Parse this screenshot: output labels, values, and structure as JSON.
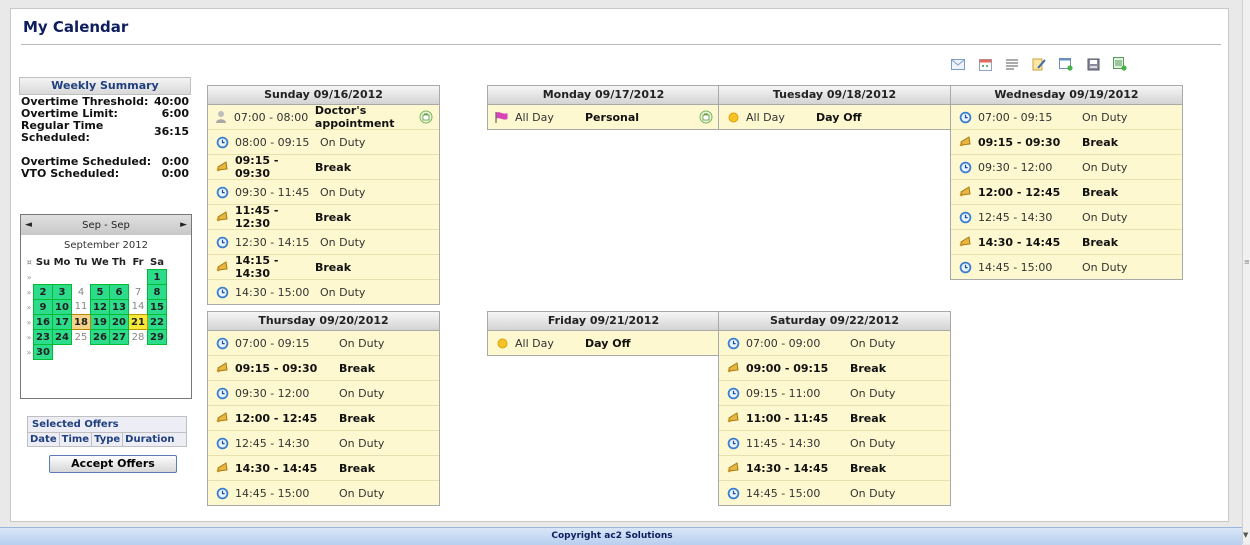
{
  "page": {
    "title": "My Calendar"
  },
  "toolbar": {
    "icons": [
      "email-icon",
      "calendar-icon",
      "list-icon",
      "edit-note-icon",
      "new-window-icon",
      "print-icon",
      "export-icon"
    ]
  },
  "summary": {
    "title": "Weekly Summary",
    "rows": [
      {
        "label": "Overtime Threshold:",
        "value": "40:00"
      },
      {
        "label": "Overtime Limit:",
        "value": "6:00"
      },
      {
        "label": "Regular Time Scheduled:",
        "value": "36:15"
      },
      {
        "label": "Overtime Scheduled:",
        "value": "0:00"
      },
      {
        "label": "VTO Scheduled:",
        "value": "0:00"
      }
    ]
  },
  "mini_calendar": {
    "range": "Sep - Sep",
    "month": "September 2012",
    "prev": "◄",
    "next": "►",
    "weekdays": [
      "Su",
      "Mo",
      "Tu",
      "We",
      "Th",
      "Fr",
      "Sa"
    ],
    "weeks": [
      [
        null,
        null,
        null,
        null,
        null,
        null,
        {
          "d": "1",
          "s": "avail"
        }
      ],
      [
        {
          "d": "2",
          "s": "avail"
        },
        {
          "d": "3",
          "s": "avail"
        },
        {
          "d": "4",
          "s": "off"
        },
        {
          "d": "5",
          "s": "avail"
        },
        {
          "d": "6",
          "s": "avail"
        },
        {
          "d": "7",
          "s": "off"
        },
        {
          "d": "8",
          "s": "avail"
        }
      ],
      [
        {
          "d": "9",
          "s": "avail"
        },
        {
          "d": "10",
          "s": "avail"
        },
        {
          "d": "11",
          "s": "off"
        },
        {
          "d": "12",
          "s": "avail"
        },
        {
          "d": "13",
          "s": "avail"
        },
        {
          "d": "14",
          "s": "off"
        },
        {
          "d": "15",
          "s": "avail"
        }
      ],
      [
        {
          "d": "16",
          "s": "avail"
        },
        {
          "d": "17",
          "s": "avail"
        },
        {
          "d": "18",
          "s": "today"
        },
        {
          "d": "19",
          "s": "avail"
        },
        {
          "d": "20",
          "s": "avail"
        },
        {
          "d": "21",
          "s": "sel"
        },
        {
          "d": "22",
          "s": "avail"
        }
      ],
      [
        {
          "d": "23",
          "s": "avail"
        },
        {
          "d": "24",
          "s": "avail"
        },
        {
          "d": "25",
          "s": "off"
        },
        {
          "d": "26",
          "s": "avail"
        },
        {
          "d": "27",
          "s": "avail"
        },
        {
          "d": "28",
          "s": "off"
        },
        {
          "d": "29",
          "s": "avail"
        }
      ],
      [
        {
          "d": "30",
          "s": "avail"
        },
        null,
        null,
        null,
        null,
        null,
        null
      ]
    ]
  },
  "offers": {
    "title": "Selected Offers",
    "columns": [
      "Date",
      "Time",
      "Type",
      "Duration"
    ],
    "accept_label": "Accept Offers"
  },
  "days": [
    {
      "title": "Sunday 09/16/2012",
      "events": [
        {
          "icon": "appointment",
          "time": "07:00 - 08:00",
          "label": "Doctor's appointment",
          "bold": false,
          "labelBold": true,
          "side": true
        },
        {
          "icon": "clock",
          "time": "08:00 - 09:15",
          "label": "On Duty",
          "bold": false
        },
        {
          "icon": "break",
          "time": "09:15 - 09:30",
          "label": "Break",
          "bold": true
        },
        {
          "icon": "clock",
          "time": "09:30 - 11:45",
          "label": "On Duty",
          "bold": false
        },
        {
          "icon": "break",
          "time": "11:45 - 12:30",
          "label": "Break",
          "bold": true
        },
        {
          "icon": "clock",
          "time": "12:30 - 14:15",
          "label": "On Duty",
          "bold": false
        },
        {
          "icon": "break",
          "time": "14:15 - 14:30",
          "label": "Break",
          "bold": true
        },
        {
          "icon": "clock",
          "time": "14:30 - 15:00",
          "label": "On Duty",
          "bold": false
        }
      ]
    },
    {
      "title": "Monday 09/17/2012",
      "events": [
        {
          "icon": "flag",
          "time": "All Day",
          "label": "Personal",
          "bold": false,
          "labelBold": true,
          "side": true
        }
      ]
    },
    {
      "title": "Tuesday 09/18/2012",
      "events": [
        {
          "icon": "sun",
          "time": "All Day",
          "label": "Day Off",
          "bold": false,
          "labelBold": true
        }
      ]
    },
    {
      "title": "Wednesday 09/19/2012",
      "events": [
        {
          "icon": "clock",
          "time": "07:00 - 09:15",
          "label": "On Duty",
          "bold": false
        },
        {
          "icon": "break",
          "time": "09:15 - 09:30",
          "label": "Break",
          "bold": true
        },
        {
          "icon": "clock",
          "time": "09:30 - 12:00",
          "label": "On Duty",
          "bold": false
        },
        {
          "icon": "break",
          "time": "12:00 - 12:45",
          "label": "Break",
          "bold": true
        },
        {
          "icon": "clock",
          "time": "12:45 - 14:30",
          "label": "On Duty",
          "bold": false
        },
        {
          "icon": "break",
          "time": "14:30 - 14:45",
          "label": "Break",
          "bold": true
        },
        {
          "icon": "clock",
          "time": "14:45 - 15:00",
          "label": "On Duty",
          "bold": false
        }
      ]
    },
    {
      "title": "Thursday 09/20/2012",
      "events": [
        {
          "icon": "clock",
          "time": "07:00 - 09:15",
          "label": "On Duty",
          "bold": false
        },
        {
          "icon": "break",
          "time": "09:15 - 09:30",
          "label": "Break",
          "bold": true
        },
        {
          "icon": "clock",
          "time": "09:30 - 12:00",
          "label": "On Duty",
          "bold": false
        },
        {
          "icon": "break",
          "time": "12:00 - 12:45",
          "label": "Break",
          "bold": true
        },
        {
          "icon": "clock",
          "time": "12:45 - 14:30",
          "label": "On Duty",
          "bold": false
        },
        {
          "icon": "break",
          "time": "14:30 - 14:45",
          "label": "Break",
          "bold": true
        },
        {
          "icon": "clock",
          "time": "14:45 - 15:00",
          "label": "On Duty",
          "bold": false
        }
      ]
    },
    {
      "title": "Friday 09/21/2012",
      "events": [
        {
          "icon": "sun",
          "time": "All Day",
          "label": "Day Off",
          "bold": false,
          "labelBold": true
        }
      ]
    },
    {
      "title": "Saturday 09/22/2012",
      "events": [
        {
          "icon": "clock",
          "time": "07:00 - 09:00",
          "label": "On Duty",
          "bold": false
        },
        {
          "icon": "break",
          "time": "09:00 - 09:15",
          "label": "Break",
          "bold": true
        },
        {
          "icon": "clock",
          "time": "09:15 - 11:00",
          "label": "On Duty",
          "bold": false
        },
        {
          "icon": "break",
          "time": "11:00 - 11:45",
          "label": "Break",
          "bold": true
        },
        {
          "icon": "clock",
          "time": "11:45 - 14:30",
          "label": "On Duty",
          "bold": false
        },
        {
          "icon": "break",
          "time": "14:30 - 14:45",
          "label": "Break",
          "bold": true
        },
        {
          "icon": "clock",
          "time": "14:45 - 15:00",
          "label": "On Duty",
          "bold": false
        }
      ]
    }
  ],
  "footer": {
    "text": "Copyright ac2 Solutions"
  }
}
